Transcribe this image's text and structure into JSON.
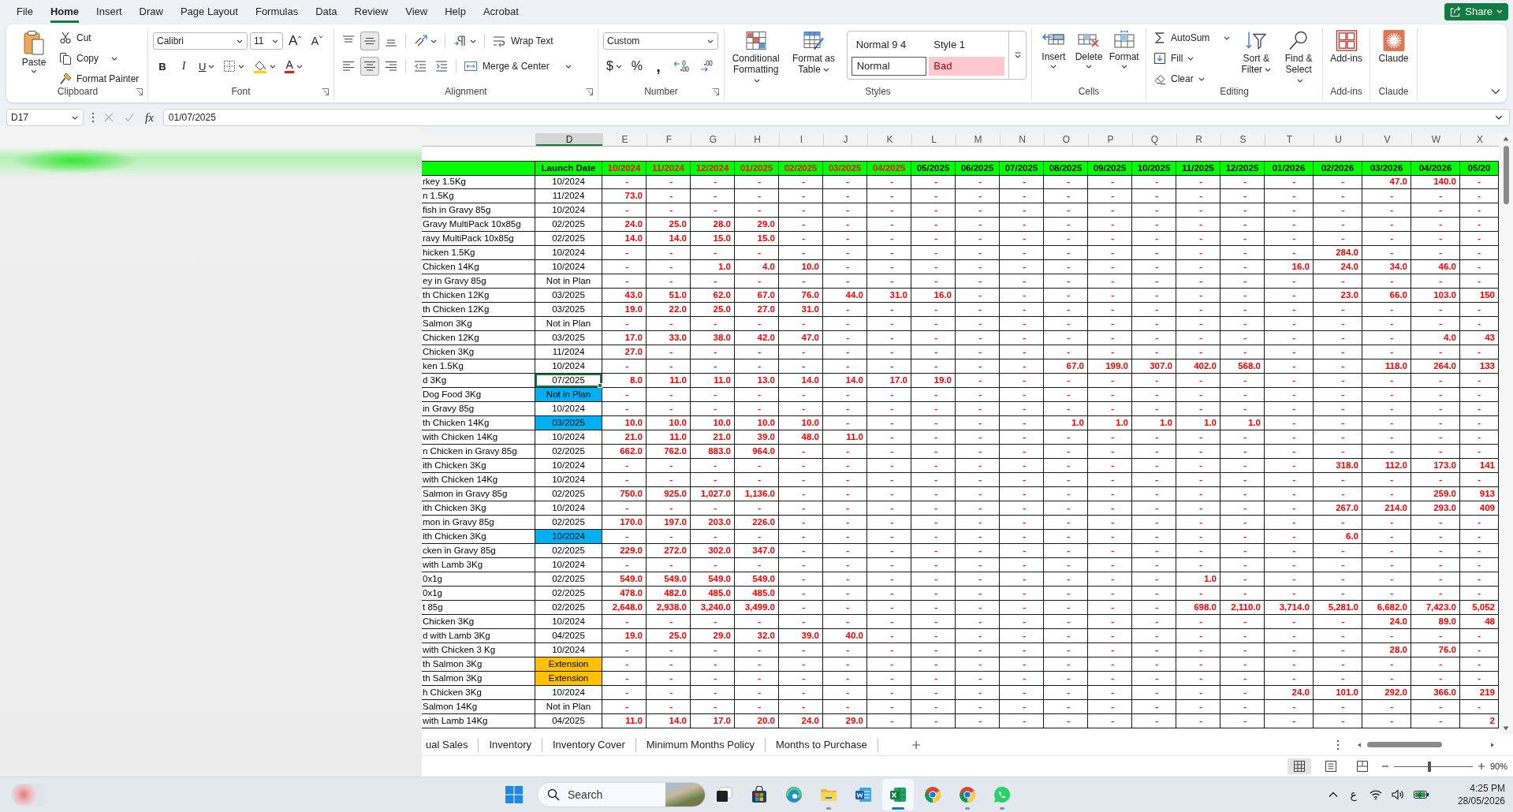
{
  "menu": {
    "tabs": [
      {
        "label": "File",
        "selected": false
      },
      {
        "label": "Home",
        "selected": true
      },
      {
        "label": "Insert",
        "selected": false
      },
      {
        "label": "Draw",
        "selected": false
      },
      {
        "label": "Page Layout",
        "selected": false
      },
      {
        "label": "Formulas",
        "selected": false
      },
      {
        "label": "Data",
        "selected": false
      },
      {
        "label": "Review",
        "selected": false
      },
      {
        "label": "View",
        "selected": false
      },
      {
        "label": "Help",
        "selected": false
      },
      {
        "label": "Acrobat",
        "selected": false
      }
    ],
    "share": "Share"
  },
  "ribbon": {
    "clipboard": {
      "label": "Clipboard",
      "paste": "Paste",
      "cut": "Cut",
      "copy": "Copy",
      "format_painter": "Format Painter"
    },
    "font": {
      "label": "Font",
      "name": "Calibri",
      "size": "11",
      "grow": "A",
      "shrink": "A",
      "bold": "B",
      "italic": "I",
      "underline": "U",
      "font_color": "A"
    },
    "alignment": {
      "label": "Alignment",
      "vertical": [
        {
          "kind": "top",
          "selected": false
        },
        {
          "kind": "middle",
          "selected": true
        },
        {
          "kind": "bottom",
          "selected": false
        }
      ],
      "horizontal": [
        {
          "kind": "left",
          "selected": false
        },
        {
          "kind": "center",
          "selected": true
        },
        {
          "kind": "right",
          "selected": false
        }
      ],
      "wrap_text": "Wrap Text",
      "merge_center": "Merge & Center"
    },
    "number": {
      "label": "Number",
      "format": "Custom",
      "currency": "$",
      "percent": "%",
      "comma": ","
    },
    "styles": {
      "label": "Styles",
      "conditional_formatting": "Conditional Formatting",
      "format_as_table": "Format as Table",
      "gallery": [
        {
          "label": "Normal 9 4",
          "kind": "plain"
        },
        {
          "label": "Style 1",
          "kind": "plain"
        },
        {
          "label": "Normal",
          "kind": "normal"
        },
        {
          "label": "Bad",
          "kind": "bad"
        }
      ]
    },
    "cells": {
      "label": "Cells",
      "buttons": [
        {
          "label": "Insert",
          "kind": "insert"
        },
        {
          "label": "Delete",
          "kind": "delete"
        },
        {
          "label": "Format",
          "kind": "format"
        }
      ]
    },
    "editing": {
      "label": "Editing",
      "autosum": "AutoSum",
      "fill": "Fill",
      "clear": "Clear",
      "sort_filter": "Sort & Filter",
      "find_select": "Find & Select"
    },
    "addins": {
      "label": "Add-ins",
      "button": "Add-ins"
    },
    "claude": {
      "label": "Claude",
      "button": "Claude"
    }
  },
  "formula_bar": {
    "name_box": "D17",
    "fx": "fx",
    "value": "01/07/2025"
  },
  "sheet": {
    "columns": [
      {
        "label": "D",
        "selected": true
      },
      {
        "label": "E",
        "selected": false
      },
      {
        "label": "F",
        "selected": false
      },
      {
        "label": "G",
        "selected": false
      },
      {
        "label": "H",
        "selected": false
      },
      {
        "label": "I",
        "selected": false
      },
      {
        "label": "J",
        "selected": false
      },
      {
        "label": "K",
        "selected": false
      },
      {
        "label": "L",
        "selected": false
      },
      {
        "label": "M",
        "selected": false
      },
      {
        "label": "N",
        "selected": false
      },
      {
        "label": "O",
        "selected": false
      },
      {
        "label": "P",
        "selected": false
      },
      {
        "label": "Q",
        "selected": false
      },
      {
        "label": "R",
        "selected": false
      },
      {
        "label": "S",
        "selected": false
      },
      {
        "label": "T",
        "selected": false
      },
      {
        "label": "U",
        "selected": false
      },
      {
        "label": "V",
        "selected": false
      },
      {
        "label": "W",
        "selected": false
      },
      {
        "label": "X",
        "selected": false
      }
    ],
    "launch_heading": "Launch Date",
    "months": [
      {
        "label": "10/2024",
        "flagged": true
      },
      {
        "label": "11/2024",
        "flagged": true
      },
      {
        "label": "12/2024",
        "flagged": true
      },
      {
        "label": "01/2025",
        "flagged": true
      },
      {
        "label": "02/2025",
        "flagged": true
      },
      {
        "label": "03/2025",
        "flagged": true
      },
      {
        "label": "04/2025",
        "flagged": true
      },
      {
        "label": "05/2025",
        "flagged": false
      },
      {
        "label": "06/2025",
        "flagged": false
      },
      {
        "label": "07/2025",
        "flagged": false
      },
      {
        "label": "08/2025",
        "flagged": false
      },
      {
        "label": "09/2025",
        "flagged": false
      },
      {
        "label": "10/2025",
        "flagged": false
      },
      {
        "label": "11/2025",
        "flagged": false
      },
      {
        "label": "12/2025",
        "flagged": false
      },
      {
        "label": "01/2026",
        "flagged": false
      },
      {
        "label": "02/2026",
        "flagged": false
      },
      {
        "label": "03/2026",
        "flagged": false
      },
      {
        "label": "04/2026",
        "flagged": false
      },
      {
        "label": "05/20",
        "flagged": false
      }
    ],
    "rows": [
      {
        "product": "rkey 1.5Kg",
        "launch": {
          "text": "10/2024",
          "selected": false
        },
        "values": [
          "-",
          "-",
          "-",
          "-",
          "-",
          "-",
          "-",
          "-",
          "-",
          "-",
          "-",
          "-",
          "-",
          "-",
          "-",
          "-",
          "-",
          "47.0",
          "140.0",
          "-"
        ]
      },
      {
        "product": "n 1.5Kg",
        "launch": {
          "text": "11/2024",
          "selected": false
        },
        "values": [
          "73.0",
          "-",
          "-",
          "-",
          "-",
          "-",
          "-",
          "-",
          "-",
          "-",
          "-",
          "-",
          "-",
          "-",
          "-",
          "-",
          "-",
          "-",
          "-",
          "-"
        ]
      },
      {
        "product": "fish in Gravy 85g",
        "launch": {
          "text": "10/2024",
          "selected": false
        },
        "values": [
          "-",
          "-",
          "-",
          "-",
          "-",
          "-",
          "-",
          "-",
          "-",
          "-",
          "-",
          "-",
          "-",
          "-",
          "-",
          "-",
          "-",
          "-",
          "-",
          "-"
        ]
      },
      {
        "product": "Gravy MultiPack 10x85g",
        "launch": {
          "text": "02/2025",
          "selected": false
        },
        "values": [
          "24.0",
          "25.0",
          "28.0",
          "29.0",
          "-",
          "-",
          "-",
          "-",
          "-",
          "-",
          "-",
          "-",
          "-",
          "-",
          "-",
          "-",
          "-",
          "-",
          "-",
          "-"
        ]
      },
      {
        "product": "ravy MultiPack 10x85g",
        "launch": {
          "text": "02/2025",
          "selected": false
        },
        "values": [
          "14.0",
          "14.0",
          "15.0",
          "15.0",
          "-",
          "-",
          "-",
          "-",
          "-",
          "-",
          "-",
          "-",
          "-",
          "-",
          "-",
          "-",
          "-",
          "-",
          "-",
          "-"
        ]
      },
      {
        "product": "hicken 1.5Kg",
        "launch": {
          "text": "10/2024",
          "selected": false
        },
        "values": [
          "-",
          "-",
          "-",
          "-",
          "-",
          "-",
          "-",
          "-",
          "-",
          "-",
          "-",
          "-",
          "-",
          "-",
          "-",
          "-",
          "284.0",
          "-",
          "-",
          "-"
        ]
      },
      {
        "product": "Chicken 14Kg",
        "launch": {
          "text": "10/2024",
          "selected": false
        },
        "values": [
          "-",
          "-",
          "1.0",
          "4.0",
          "10.0",
          "-",
          "-",
          "-",
          "-",
          "-",
          "-",
          "-",
          "-",
          "-",
          "-",
          "16.0",
          "24.0",
          "34.0",
          "46.0",
          "-"
        ]
      },
      {
        "product": "ey in Gravy 85g",
        "launch": {
          "text": "Not in Plan",
          "selected": false
        },
        "values": [
          "-",
          "-",
          "-",
          "-",
          "-",
          "-",
          "-",
          "-",
          "-",
          "-",
          "-",
          "-",
          "-",
          "-",
          "-",
          "-",
          "-",
          "-",
          "-",
          "-"
        ]
      },
      {
        "product": "th Chicken 12Kg",
        "launch": {
          "text": "03/2025",
          "selected": false
        },
        "values": [
          "43.0",
          "51.0",
          "62.0",
          "67.0",
          "76.0",
          "44.0",
          "31.0",
          "16.0",
          "-",
          "-",
          "-",
          "-",
          "-",
          "-",
          "-",
          "-",
          "23.0",
          "66.0",
          "103.0",
          "150"
        ]
      },
      {
        "product": "th Chicken 12Kg",
        "launch": {
          "text": "03/2025",
          "selected": false
        },
        "values": [
          "19.0",
          "22.0",
          "25.0",
          "27.0",
          "31.0",
          "-",
          "-",
          "-",
          "-",
          "-",
          "-",
          "-",
          "-",
          "-",
          "-",
          "-",
          "-",
          "-",
          "-",
          "-"
        ]
      },
      {
        "product": "Salmon 3Kg",
        "launch": {
          "text": "Not in Plan",
          "selected": false
        },
        "values": [
          "-",
          "-",
          "-",
          "-",
          "-",
          "-",
          "-",
          "-",
          "-",
          "-",
          "-",
          "-",
          "-",
          "-",
          "-",
          "-",
          "-",
          "-",
          "-",
          "-"
        ]
      },
      {
        "product": "Chicken 12Kg",
        "launch": {
          "text": "03/2025",
          "selected": false
        },
        "values": [
          "17.0",
          "33.0",
          "38.0",
          "42.0",
          "47.0",
          "-",
          "-",
          "-",
          "-",
          "-",
          "-",
          "-",
          "-",
          "-",
          "-",
          "-",
          "-",
          "-",
          "4.0",
          "43"
        ]
      },
      {
        "product": "Chicken 3Kg",
        "launch": {
          "text": "11/2024",
          "selected": false
        },
        "values": [
          "27.0",
          "-",
          "-",
          "-",
          "-",
          "-",
          "-",
          "-",
          "-",
          "-",
          "-",
          "-",
          "-",
          "-",
          "-",
          "-",
          "-",
          "-",
          "-",
          "-"
        ]
      },
      {
        "product": "ken 1.5Kg",
        "launch": {
          "text": "10/2024",
          "selected": false
        },
        "values": [
          "-",
          "-",
          "-",
          "-",
          "-",
          "-",
          "-",
          "-",
          "-",
          "-",
          "67.0",
          "199.0",
          "307.0",
          "402.0",
          "568.0",
          "-",
          "-",
          "118.0",
          "264.0",
          "133"
        ]
      },
      {
        "product": "d 3Kg",
        "launch": {
          "text": "07/2025",
          "selected": true
        },
        "values": [
          "8.0",
          "11.0",
          "11.0",
          "13.0",
          "14.0",
          "14.0",
          "17.0",
          "19.0",
          "-",
          "-",
          "-",
          "-",
          "-",
          "-",
          "-",
          "-",
          "-",
          "-",
          "-",
          "-"
        ]
      },
      {
        "product": "Dog Food 3Kg",
        "launch": {
          "text": "Not in Plan",
          "selected": false,
          "color": "#00b0f0"
        },
        "values": [
          "-",
          "-",
          "-",
          "-",
          "-",
          "-",
          "-",
          "-",
          "-",
          "-",
          "-",
          "-",
          "-",
          "-",
          "-",
          "-",
          "-",
          "-",
          "-",
          "-"
        ]
      },
      {
        "product": "in Gravy 85g",
        "launch": {
          "text": "10/2024",
          "selected": false
        },
        "values": [
          "-",
          "-",
          "-",
          "-",
          "-",
          "-",
          "-",
          "-",
          "-",
          "-",
          "-",
          "-",
          "-",
          "-",
          "-",
          "-",
          "-",
          "-",
          "-",
          "-"
        ]
      },
      {
        "product": "th Chicken 14Kg",
        "launch": {
          "text": "03/2025",
          "selected": false,
          "color": "#00b0f0"
        },
        "values": [
          "10.0",
          "10.0",
          "10.0",
          "10.0",
          "10.0",
          "-",
          "-",
          "-",
          "-",
          "-",
          "1.0",
          "1.0",
          "1.0",
          "1.0",
          "1.0",
          "-",
          "-",
          "-",
          "-",
          "-"
        ]
      },
      {
        "product": "with Chicken 14Kg",
        "launch": {
          "text": "10/2024",
          "selected": false
        },
        "values": [
          "21.0",
          "11.0",
          "21.0",
          "39.0",
          "48.0",
          "11.0",
          "-",
          "-",
          "-",
          "-",
          "-",
          "-",
          "-",
          "-",
          "-",
          "-",
          "-",
          "-",
          "-",
          "-"
        ]
      },
      {
        "product": "n Chicken in Gravy 85g",
        "launch": {
          "text": "02/2025",
          "selected": false
        },
        "values": [
          "662.0",
          "762.0",
          "883.0",
          "964.0",
          "-",
          "-",
          "-",
          "-",
          "-",
          "-",
          "-",
          "-",
          "-",
          "-",
          "-",
          "-",
          "-",
          "-",
          "-",
          "-"
        ]
      },
      {
        "product": "ith Chicken 3Kg",
        "launch": {
          "text": "10/2024",
          "selected": false
        },
        "values": [
          "-",
          "-",
          "-",
          "-",
          "-",
          "-",
          "-",
          "-",
          "-",
          "-",
          "-",
          "-",
          "-",
          "-",
          "-",
          "-",
          "318.0",
          "112.0",
          "173.0",
          "141"
        ]
      },
      {
        "product": "with Chicken 14Kg",
        "launch": {
          "text": "10/2024",
          "selected": false
        },
        "values": [
          "-",
          "-",
          "-",
          "-",
          "-",
          "-",
          "-",
          "-",
          "-",
          "-",
          "-",
          "-",
          "-",
          "-",
          "-",
          "-",
          "-",
          "-",
          "-",
          "-"
        ]
      },
      {
        "product": "Salmon in Gravy 85g",
        "launch": {
          "text": "02/2025",
          "selected": false
        },
        "values": [
          "750.0",
          "925.0",
          "1,027.0",
          "1,136.0",
          "-",
          "-",
          "-",
          "-",
          "-",
          "-",
          "-",
          "-",
          "-",
          "-",
          "-",
          "-",
          "-",
          "-",
          "259.0",
          "913"
        ]
      },
      {
        "product": "ith Chicken 3Kg",
        "launch": {
          "text": "10/2024",
          "selected": false
        },
        "values": [
          "-",
          "-",
          "-",
          "-",
          "-",
          "-",
          "-",
          "-",
          "-",
          "-",
          "-",
          "-",
          "-",
          "-",
          "-",
          "-",
          "267.0",
          "214.0",
          "293.0",
          "409"
        ]
      },
      {
        "product": "mon in Gravy 85g",
        "launch": {
          "text": "02/2025",
          "selected": false
        },
        "values": [
          "170.0",
          "197.0",
          "203.0",
          "226.0",
          "-",
          "-",
          "-",
          "-",
          "-",
          "-",
          "-",
          "-",
          "-",
          "-",
          "-",
          "-",
          "-",
          "-",
          "-",
          "-"
        ]
      },
      {
        "product": "ith Chicken 3Kg",
        "launch": {
          "text": "10/2024",
          "selected": false,
          "color": "#00b0f0"
        },
        "values": [
          "-",
          "-",
          "-",
          "-",
          "-",
          "-",
          "-",
          "-",
          "-",
          "-",
          "-",
          "-",
          "-",
          "-",
          "-",
          "-",
          "6.0",
          "-",
          "-",
          "-"
        ]
      },
      {
        "product": "cken in Gravy 85g",
        "launch": {
          "text": "02/2025",
          "selected": false
        },
        "values": [
          "229.0",
          "272.0",
          "302.0",
          "347.0",
          "-",
          "-",
          "-",
          "-",
          "-",
          "-",
          "-",
          "-",
          "-",
          "-",
          "-",
          "-",
          "-",
          "-",
          "-",
          "-"
        ]
      },
      {
        "product": "with Lamb 3Kg",
        "launch": {
          "text": "10/2024",
          "selected": false
        },
        "values": [
          "-",
          "-",
          "-",
          "-",
          "-",
          "-",
          "-",
          "-",
          "-",
          "-",
          "-",
          "-",
          "-",
          "-",
          "-",
          "-",
          "-",
          "-",
          "-",
          "-"
        ]
      },
      {
        "product": "0x1g",
        "launch": {
          "text": "02/2025",
          "selected": false
        },
        "values": [
          "549.0",
          "549.0",
          "549.0",
          "549.0",
          "-",
          "-",
          "-",
          "-",
          "-",
          "-",
          "-",
          "-",
          "-",
          "1.0",
          "-",
          "-",
          "-",
          "-",
          "-",
          "-"
        ]
      },
      {
        "product": "0x1g",
        "launch": {
          "text": "02/2025",
          "selected": false
        },
        "values": [
          "478.0",
          "482.0",
          "485.0",
          "485.0",
          "-",
          "-",
          "-",
          "-",
          "-",
          "-",
          "-",
          "-",
          "-",
          "-",
          "-",
          "-",
          "-",
          "-",
          "-",
          "-"
        ]
      },
      {
        "product": "t 85g",
        "launch": {
          "text": "02/2025",
          "selected": false
        },
        "values": [
          "2,648.0",
          "2,938.0",
          "3,240.0",
          "3,499.0",
          "-",
          "-",
          "-",
          "-",
          "-",
          "-",
          "-",
          "-",
          "-",
          "698.0",
          "2,110.0",
          "3,714.0",
          "5,281.0",
          "6,682.0",
          "7,423.0",
          "5,052"
        ]
      },
      {
        "product": "Chicken 3Kg",
        "launch": {
          "text": "10/2024",
          "selected": false
        },
        "values": [
          "-",
          "-",
          "-",
          "-",
          "-",
          "-",
          "-",
          "-",
          "-",
          "-",
          "-",
          "-",
          "-",
          "-",
          "-",
          "-",
          "-",
          "24.0",
          "89.0",
          "48"
        ]
      },
      {
        "product": "d with Lamb 3Kg",
        "launch": {
          "text": "04/2025",
          "selected": false
        },
        "values": [
          "19.0",
          "25.0",
          "29.0",
          "32.0",
          "39.0",
          "40.0",
          "-",
          "-",
          "-",
          "-",
          "-",
          "-",
          "-",
          "-",
          "-",
          "-",
          "-",
          "-",
          "-",
          "-"
        ]
      },
      {
        "product": "with Chicken 3 Kg",
        "launch": {
          "text": "10/2024",
          "selected": false
        },
        "values": [
          "-",
          "-",
          "-",
          "-",
          "-",
          "-",
          "-",
          "-",
          "-",
          "-",
          "-",
          "-",
          "-",
          "-",
          "-",
          "-",
          "-",
          "28.0",
          "76.0",
          "-"
        ]
      },
      {
        "product": "th Salmon 3Kg",
        "launch": {
          "text": "Extension",
          "selected": false,
          "color": "#ffc000"
        },
        "values": [
          "-",
          "-",
          "-",
          "-",
          "-",
          "-",
          "-",
          "-",
          "-",
          "-",
          "-",
          "-",
          "-",
          "-",
          "-",
          "-",
          "-",
          "-",
          "-",
          "-"
        ]
      },
      {
        "product": "th Salmon 3Kg",
        "launch": {
          "text": "Extension",
          "selected": false,
          "color": "#ffc000"
        },
        "values": [
          "-",
          "-",
          "-",
          "-",
          "-",
          "-",
          "-",
          "-",
          "-",
          "-",
          "-",
          "-",
          "-",
          "-",
          "-",
          "-",
          "-",
          "-",
          "-",
          "-"
        ]
      },
      {
        "product": "h Chicken 3Kg",
        "launch": {
          "text": "10/2024",
          "selected": false
        },
        "values": [
          "-",
          "-",
          "-",
          "-",
          "-",
          "-",
          "-",
          "-",
          "-",
          "-",
          "-",
          "-",
          "-",
          "-",
          "-",
          "24.0",
          "101.0",
          "292.0",
          "366.0",
          "219"
        ]
      },
      {
        "product": "Salmon 14Kg",
        "launch": {
          "text": "Not in Plan",
          "selected": false
        },
        "values": [
          "-",
          "-",
          "-",
          "-",
          "-",
          "-",
          "-",
          "-",
          "-",
          "-",
          "-",
          "-",
          "-",
          "-",
          "-",
          "-",
          "-",
          "-",
          "-",
          "-"
        ]
      },
      {
        "product": "with Lamb 14Kg",
        "launch": {
          "text": "04/2025",
          "selected": false
        },
        "values": [
          "11.0",
          "14.0",
          "17.0",
          "20.0",
          "24.0",
          "29.0",
          "-",
          "-",
          "-",
          "-",
          "-",
          "-",
          "-",
          "-",
          "-",
          "-",
          "-",
          "-",
          "-",
          "2"
        ]
      }
    ]
  },
  "sheet_tabs": [
    {
      "label": "ual Sales",
      "selected": false
    },
    {
      "label": "Inventory",
      "selected": false
    },
    {
      "label": "Inventory Cover",
      "selected": false
    },
    {
      "label": "Minimum Months Policy",
      "selected": false
    },
    {
      "label": "Months to Purchase",
      "selected": false
    }
  ],
  "status_bar": {
    "views": [
      {
        "kind": "normal",
        "selected": true
      },
      {
        "kind": "page_layout",
        "selected": false
      },
      {
        "kind": "page_break",
        "selected": false
      }
    ],
    "zoom": {
      "level": 0.45,
      "label": "90%"
    }
  },
  "taskbar": {
    "search": {
      "placeholder": "Search"
    },
    "apps": [
      {
        "kind": "taskview",
        "running": false,
        "selected": false
      },
      {
        "kind": "store",
        "running": false,
        "selected": false
      },
      {
        "kind": "edge",
        "running": false,
        "selected": false
      },
      {
        "kind": "explorer",
        "running": true,
        "selected": false
      },
      {
        "kind": "word",
        "running": false,
        "selected": false
      },
      {
        "kind": "excel",
        "running": true,
        "selected": true
      },
      {
        "kind": "chrome",
        "running": false,
        "selected": false
      },
      {
        "kind": "chrome",
        "running": true,
        "selected": false
      },
      {
        "kind": "whatsapp",
        "running": true,
        "selected": false
      }
    ],
    "tray": {
      "language": "ع",
      "time": "4:25 PM",
      "date": "28/05/2026"
    }
  }
}
